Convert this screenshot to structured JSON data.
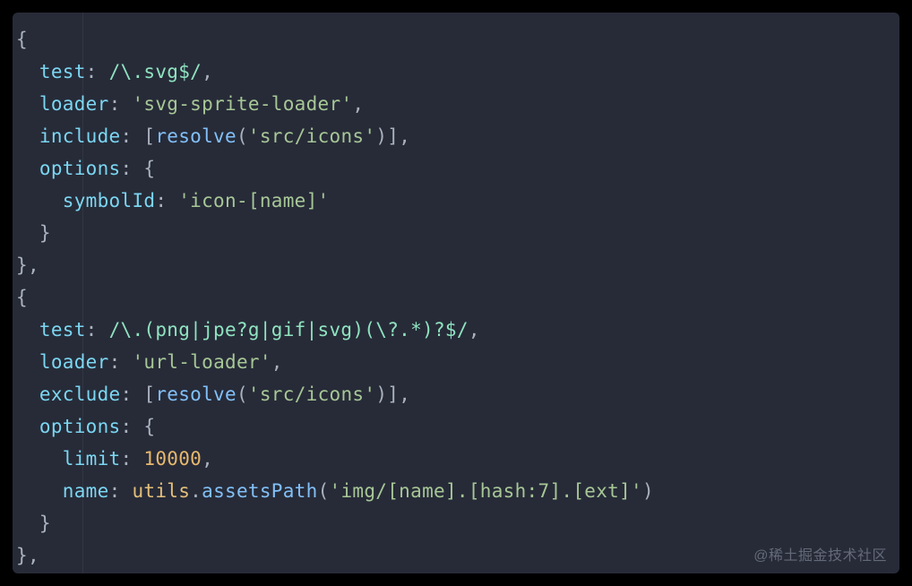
{
  "colors": {
    "background": "#272b38",
    "default": "#abb2bf",
    "key": "#d6a4f4",
    "keyCyan": "#7bd6f2",
    "regex": "#8fe3c0",
    "regexGroup": "#d19a66",
    "string": "#a7c796",
    "number": "#e7b86e",
    "identifier": "#e5c07b",
    "funcCall": "#82c0f8",
    "watermark": "#6f7684"
  },
  "code": {
    "rules": [
      {
        "test": "/\\.svg$/",
        "loader": "svg-sprite-loader",
        "include_fn": "resolve",
        "include_arg": "src/icons",
        "options": {
          "symbolId": "icon-[name]"
        }
      },
      {
        "test": "/\\.(png|jpe?g|gif|svg)(\\?.*)?$/",
        "loader": "url-loader",
        "exclude_fn": "resolve",
        "exclude_arg": "src/icons",
        "options": {
          "limit": 10000,
          "name_obj": "utils",
          "name_fn": "assetsPath",
          "name_arg": "img/[name].[hash:7].[ext]"
        }
      }
    ],
    "raw_lines": [
      "{",
      "  test: /\\.svg$/,",
      "  loader: 'svg-sprite-loader',",
      "  include: [resolve('src/icons')],",
      "  options: {",
      "    symbolId: 'icon-[name]'",
      "  }",
      "},",
      "{",
      "  test: /\\.(png|jpe?g|gif|svg)(\\?.*)?$/,",
      "  loader: 'url-loader',",
      "  exclude: [resolve('src/icons')],",
      "  options: {",
      "    limit: 10000,",
      "    name: utils.assetsPath('img/[name].[hash:7].[ext]')",
      "  }",
      "},"
    ]
  },
  "labels": {
    "test": "test",
    "loader": "loader",
    "include": "include",
    "exclude": "exclude",
    "options": "options",
    "symbolId": "symbolId",
    "limit": "limit",
    "name": "name"
  },
  "watermark": "@稀土掘金技术社区"
}
